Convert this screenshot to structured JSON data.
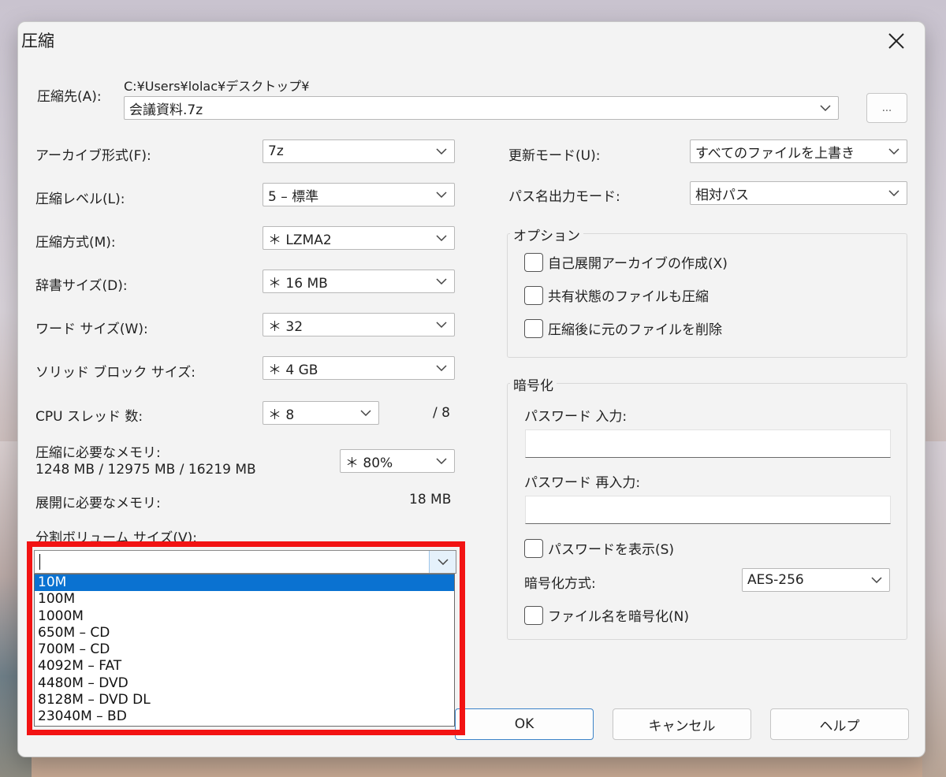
{
  "dialog": {
    "title": "圧縮",
    "close_icon": "close-icon"
  },
  "destination": {
    "label": "圧縮先(A):",
    "path": "C:¥Users¥lolac¥デスクトップ¥",
    "value": "会議資料.7z",
    "browse_label": "..."
  },
  "left": {
    "archive_format": {
      "label": "アーカイブ形式(F):",
      "value": "7z"
    },
    "compression_level": {
      "label": "圧縮レベル(L):",
      "value": "5 – 標準"
    },
    "compression_method": {
      "label": "圧縮方式(M):",
      "value": "＊  LZMA2"
    },
    "dictionary_size": {
      "label": "辞書サイズ(D):",
      "value": "＊  16 MB"
    },
    "word_size": {
      "label": "ワード サイズ(W):",
      "value": "＊  32"
    },
    "solid_block_size": {
      "label": "ソリッド ブロック サイズ:",
      "value": "＊  4 GB"
    },
    "cpu_threads": {
      "label": "CPU スレッド 数:",
      "value": "＊  8",
      "max": "/ 8"
    },
    "memory_compress": {
      "label": "圧縮に必要なメモリ:",
      "detail": "1248 MB / 12975 MB / 16219 MB",
      "value": "＊  80%"
    },
    "memory_extract": {
      "label": "展開に必要なメモリ:",
      "value": "18 MB"
    },
    "split_volume": {
      "label": "分割ボリューム サイズ(V):",
      "value": "",
      "options": [
        "10M",
        "100M",
        "1000M",
        "650M – CD",
        "700M – CD",
        "4092M – FAT",
        "4480M – DVD",
        "8128M – DVD DL",
        "23040M – BD"
      ],
      "selected": "10M"
    }
  },
  "right": {
    "update_mode": {
      "label": "更新モード(U):",
      "value": "すべてのファイルを上書き"
    },
    "path_mode": {
      "label": "パス名出力モード:",
      "value": "相対パス"
    },
    "options": {
      "title": "オプション",
      "items": [
        "自己展開アーカイブの作成(X)",
        "共有状態のファイルも圧縮",
        "圧縮後に元のファイルを削除"
      ]
    },
    "encryption": {
      "title": "暗号化",
      "password_label": "パスワード 入力:",
      "password_confirm_label": "パスワード 再入力:",
      "show_password": "パスワードを表示(S)",
      "method_label": "暗号化方式:",
      "method_value": "AES-256",
      "encrypt_names": "ファイル名を暗号化(N)"
    }
  },
  "buttons": {
    "ok": "OK",
    "cancel": "キャンセル",
    "help": "ヘルプ"
  },
  "colors": {
    "highlight": "#f21313",
    "selection": "#0a72d1",
    "dialog_bg": "#f3f3f3"
  }
}
